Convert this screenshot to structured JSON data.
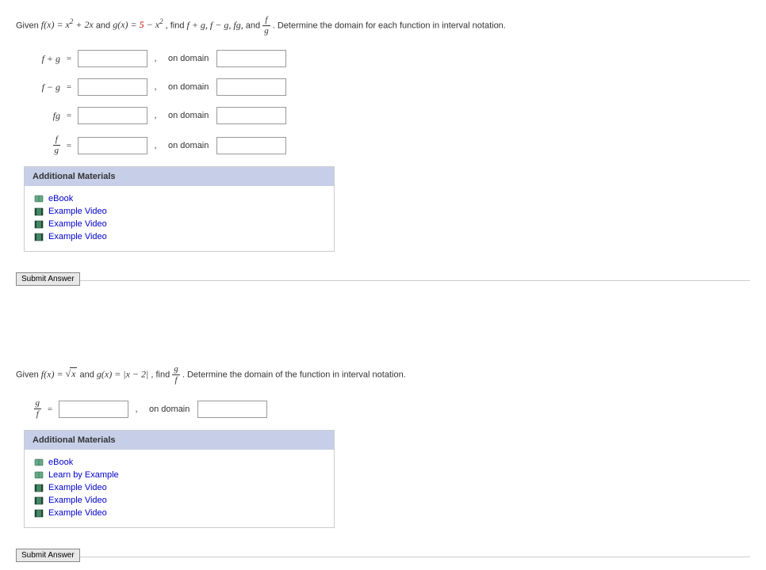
{
  "q1": {
    "prompt": {
      "p1": "Given ",
      "fx": "f(x) = x",
      "fx_after": " + 2x",
      "and1": " and ",
      "gx_pre": "g(x) = ",
      "gx_five": "5",
      "gx_post": " − x",
      "find": ", find ",
      "list": "f + g, f − g, fg,",
      "and2": " and ",
      "tail": ". Determine the domain for each function in interval notation."
    },
    "rows": [
      {
        "label": "f + g",
        "odlabel": "on domain"
      },
      {
        "label": "f − g",
        "odlabel": "on domain"
      },
      {
        "label": "fg",
        "odlabel": "on domain"
      },
      {
        "label_frac_num": "f",
        "label_frac_den": "g",
        "odlabel": "on domain"
      }
    ],
    "materials_header": "Additional Materials",
    "materials": [
      {
        "icon": "book",
        "label": "eBook"
      },
      {
        "icon": "film",
        "label": "Example Video"
      },
      {
        "icon": "film",
        "label": "Example Video"
      },
      {
        "icon": "film",
        "label": "Example Video"
      }
    ],
    "submit": "Submit Answer"
  },
  "q2": {
    "prompt": {
      "p1": "Given ",
      "fx_pre": "f(x) = ",
      "fx_rad": "x",
      "and1": " and ",
      "gx": "g(x) = |x − 2|",
      "find": ", find ",
      "tail": ". Determine the domain of the function in interval notation."
    },
    "row": {
      "label_frac_num": "g",
      "label_frac_den": "f",
      "odlabel": "on domain"
    },
    "materials_header": "Additional Materials",
    "materials": [
      {
        "icon": "book",
        "label": "eBook"
      },
      {
        "icon": "book",
        "label": "Learn by Example"
      },
      {
        "icon": "film",
        "label": "Example Video"
      },
      {
        "icon": "film",
        "label": "Example Video"
      },
      {
        "icon": "film",
        "label": "Example Video"
      }
    ],
    "submit": "Submit Answer"
  }
}
